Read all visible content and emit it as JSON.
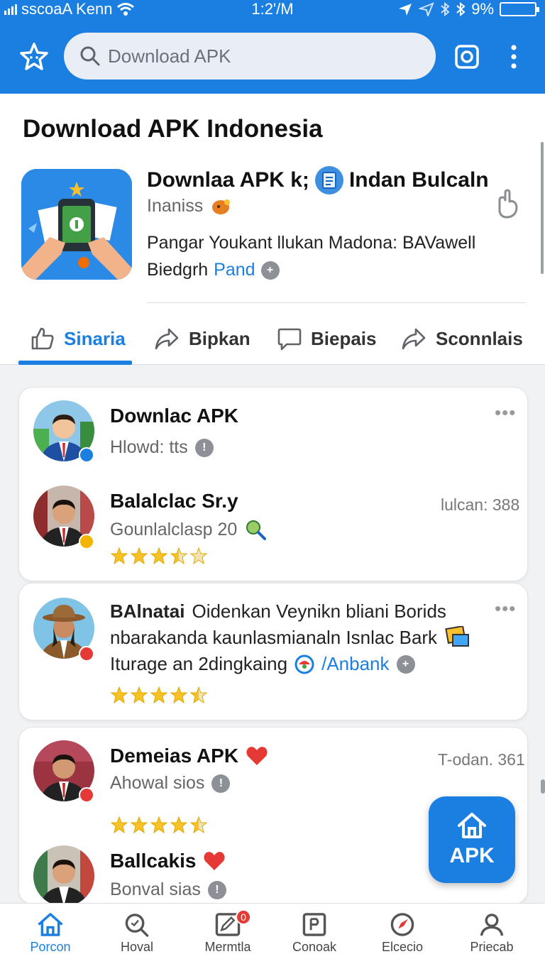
{
  "status": {
    "carrier": "sscoaA Kenn",
    "time": "1:2'/M",
    "battery": "9%"
  },
  "search": {
    "placeholder": "Download APK"
  },
  "header": {
    "title": "Download APK Indonesia",
    "app_name_1": "Downlaa APK k;",
    "app_name_2": "Indan Bulcaln",
    "app_sub": "Inaniss",
    "desc_line1": "Pangar Youkant llukan Madona: BAVawell",
    "desc_line2_text": "Biedgrh",
    "desc_line2_link": "Pand"
  },
  "tabs": [
    {
      "label": "Sinaria",
      "icon": "thumbs-up-icon"
    },
    {
      "label": "Bipkan",
      "icon": "share-icon"
    },
    {
      "label": "Biepais",
      "icon": "comment-icon"
    },
    {
      "label": "Sconnlais",
      "icon": "share-icon"
    }
  ],
  "cards": {
    "c1": {
      "name": "Downlac APK",
      "sub": "Hlowd: tts",
      "name2": "Balalclac Sr.y",
      "meta2": "lulcan: 388",
      "sub2": "Gounlalclasp  20",
      "rating2": 3.5
    },
    "c2": {
      "line1_bold": "BAlnatai",
      "line1": "Oidenkan Veynikn bliani Borids",
      "line2": "nbarakanda kaunlasmianaln Isnlac Bark",
      "line3": "Iturage an 2dingkaing",
      "line3_link": "/Anbank",
      "rating": 4.5
    },
    "c3": {
      "name": "Demeias APK",
      "meta": "T-odan. 361",
      "sub": "Ahowal sios",
      "rating": 4.5,
      "name2": "Ballcakis",
      "sub2": "Bonval sias"
    }
  },
  "fab": {
    "label": "APK"
  },
  "nav": [
    {
      "label": "Porcon",
      "icon": "home-icon"
    },
    {
      "label": "Hoval",
      "icon": "search-icon"
    },
    {
      "label": "Mermtla",
      "icon": "edit-icon",
      "badge": "0"
    },
    {
      "label": "Conoak",
      "icon": "document-icon"
    },
    {
      "label": "Elcecio",
      "icon": "compass-icon"
    },
    {
      "label": "Priecab",
      "icon": "profile-icon"
    }
  ],
  "colors": {
    "primary": "#1b7fe1",
    "star": "#f6c227",
    "badge": "#e53935"
  }
}
